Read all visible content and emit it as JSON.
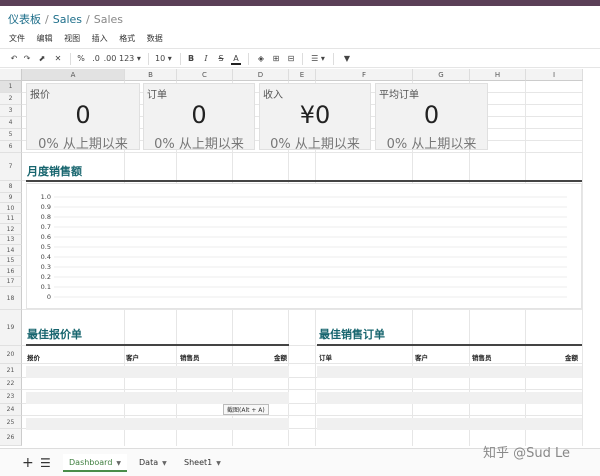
{
  "breadcrumb": {
    "root": "仪表板",
    "parent": "Sales",
    "current": "Sales"
  },
  "menu": [
    "文件",
    "编辑",
    "视图",
    "插入",
    "格式",
    "数据"
  ],
  "toolbar": {
    "percent": "%",
    "dec1": ".0",
    "dec2": ".00",
    "numfmt": "123",
    "fontsize": "10",
    "bold": "B",
    "italic": "I",
    "strike": "S",
    "textcolor": "A"
  },
  "columns": [
    "A",
    "B",
    "C",
    "D",
    "E",
    "F",
    "G",
    "H",
    "I"
  ],
  "rows": [
    "1",
    "2",
    "3",
    "4",
    "5",
    "6",
    "7",
    "8",
    "9",
    "10",
    "11",
    "12",
    "13",
    "14",
    "15",
    "16",
    "17",
    "18",
    "19",
    "20",
    "21",
    "22",
    "23",
    "24",
    "25",
    "26"
  ],
  "kpis": [
    {
      "label": "报价",
      "value": "0",
      "sub": "0% 从上期以来"
    },
    {
      "label": "订单",
      "value": "0",
      "sub": "0% 从上期以来"
    },
    {
      "label": "收入",
      "value": "¥0",
      "sub": "0% 从上期以来"
    },
    {
      "label": "平均订单",
      "value": "0",
      "sub": "0% 从上期以来"
    }
  ],
  "sections": {
    "monthly_sales": "月度销售额",
    "top_quotes": "最佳报价单",
    "top_orders": "最佳销售订单"
  },
  "chart_data": {
    "type": "line",
    "title": "",
    "xlabel": "",
    "ylabel": "",
    "ylim": [
      0,
      1.0
    ],
    "yticks": [
      "1.0",
      "0.9",
      "0.8",
      "0.7",
      "0.6",
      "0.5",
      "0.4",
      "0.3",
      "0.2",
      "0.1",
      "0"
    ],
    "series": []
  },
  "quotes_table": {
    "headers": [
      "报价",
      "客户",
      "销售员",
      "金额"
    ]
  },
  "orders_table": {
    "headers": [
      "订单",
      "客户",
      "销售员",
      "金额"
    ]
  },
  "tooltip": "截图(Alt + A)",
  "sheet_tabs": [
    {
      "label": "Dashboard",
      "active": true
    },
    {
      "label": "Data",
      "active": false
    },
    {
      "label": "Sheet1",
      "active": false
    }
  ],
  "watermark": "知乎 @Sud Le",
  "colors": {
    "accent": "#17656e",
    "breadcrumb": "#1f6f8b",
    "topbar": "#5b3f57",
    "active_tab": "#3f7f3f"
  }
}
